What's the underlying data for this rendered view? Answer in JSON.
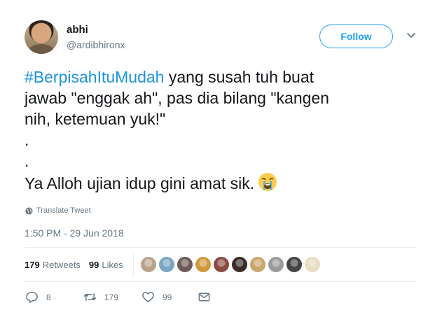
{
  "author": {
    "name": "abhi",
    "handle": "@ardibhironx"
  },
  "follow_label": "Follow",
  "tweet": {
    "hashtag": "#BerpisahItuMudah",
    "line1_rest": " yang susah tuh buat",
    "line2": "jawab \"enggak ah\", pas dia bilang \"kangen",
    "line3": "nih, ketemuan yuk!\"",
    "dot1": ".",
    "dot2": ".",
    "line6": "Ya Alloh ujian idup gini amat sik."
  },
  "translate_label": "Translate Tweet",
  "timestamp": "1:50 PM - 29 Jun 2018",
  "stats": {
    "retweets_count": "179",
    "retweets_label": "Retweets",
    "likes_count": "99",
    "likes_label": "Likes"
  },
  "liker_avatars": [
    "#b9a48a",
    "#7aa6c2",
    "#6b5a55",
    "#d09a3c",
    "#8a4b3f",
    "#3b2a2a",
    "#c9a66b",
    "#9a9a9a",
    "#444444",
    "#e8dcc2"
  ],
  "actions": {
    "reply_count": "8",
    "retweet_count": "179",
    "like_count": "99"
  },
  "colors": {
    "accent": "#1da1f2",
    "hashtag": "#1b95e0",
    "muted": "#657786"
  }
}
